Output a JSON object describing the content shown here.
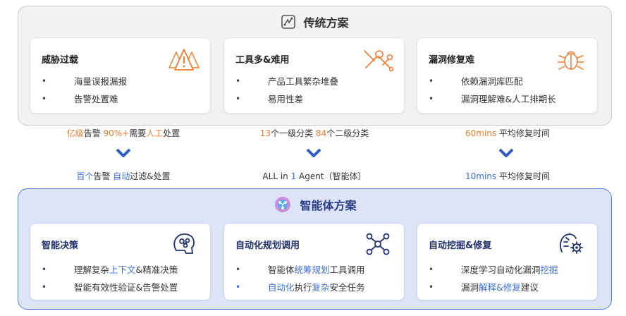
{
  "traditional": {
    "title": "传统方案",
    "icon": "traditional-solution-icon",
    "cards": [
      {
        "title": "威胁过载",
        "icon": "warning-triangles-icon",
        "items": [
          "海量误报漏报",
          "告警处置难"
        ]
      },
      {
        "title": "工具多&难用",
        "icon": "tools-wrench-icon",
        "items": [
          "产品工具繁杂堆叠",
          "易用性差"
        ]
      },
      {
        "title": "漏洞修复难",
        "icon": "bug-icon",
        "items": [
          "依赖漏洞库匹配",
          "漏洞理解难&人工排期长"
        ]
      }
    ]
  },
  "transition": {
    "before": [
      {
        "p1": "亿级",
        "p2": "告警 ",
        "p3": "90%+",
        "p4": "需要",
        "p5": "人工",
        "p6": "处置"
      },
      {
        "p1": "13",
        "p2": "个一级分类 ",
        "p3": "84",
        "p4": "个二级分类"
      },
      {
        "p1": "60mins",
        "p2": " 平均修复时间"
      }
    ],
    "after": [
      {
        "p1": "百个",
        "p2": "告警 ",
        "p3": "自动",
        "p4": "过滤&处置"
      },
      {
        "p1": "ALL in ",
        "p2": "1",
        "p3": " Agent（智能体）"
      },
      {
        "p1": "10mins",
        "p2": " 平均修复时间"
      }
    ]
  },
  "agent": {
    "title": "智能体方案",
    "icon": "ai-brain-icon",
    "cards": [
      {
        "title": "智能决策",
        "icon": "brain-head-icon",
        "items": [
          {
            "a": "理解复杂",
            "b": "上下文",
            "c": "&精准决策"
          },
          {
            "a": "智能有效性验证&告警处置",
            "b": "",
            "c": ""
          }
        ]
      },
      {
        "title": "自动化规划调用",
        "icon": "network-nodes-icon",
        "items": [
          {
            "a": "智能体",
            "b": "统筹规划",
            "c": "工具调用"
          },
          {
            "a": "自动化",
            "b": "执行",
            "c": "复杂",
            "d": "安全任务"
          }
        ]
      },
      {
        "title": "自动挖掘&修复",
        "icon": "ai-gear-head-icon",
        "items": [
          {
            "a": "深度学习自动化漏洞",
            "b": "挖掘",
            "c": ""
          },
          {
            "a": "漏洞",
            "b": "解释&修复",
            "c": "建议"
          }
        ]
      }
    ]
  },
  "colors": {
    "accent_orange": "#ed7d31",
    "accent_blue": "#3d6fd8",
    "chevron": "#2e5cc2",
    "agent_border": "#4f7fe0"
  }
}
